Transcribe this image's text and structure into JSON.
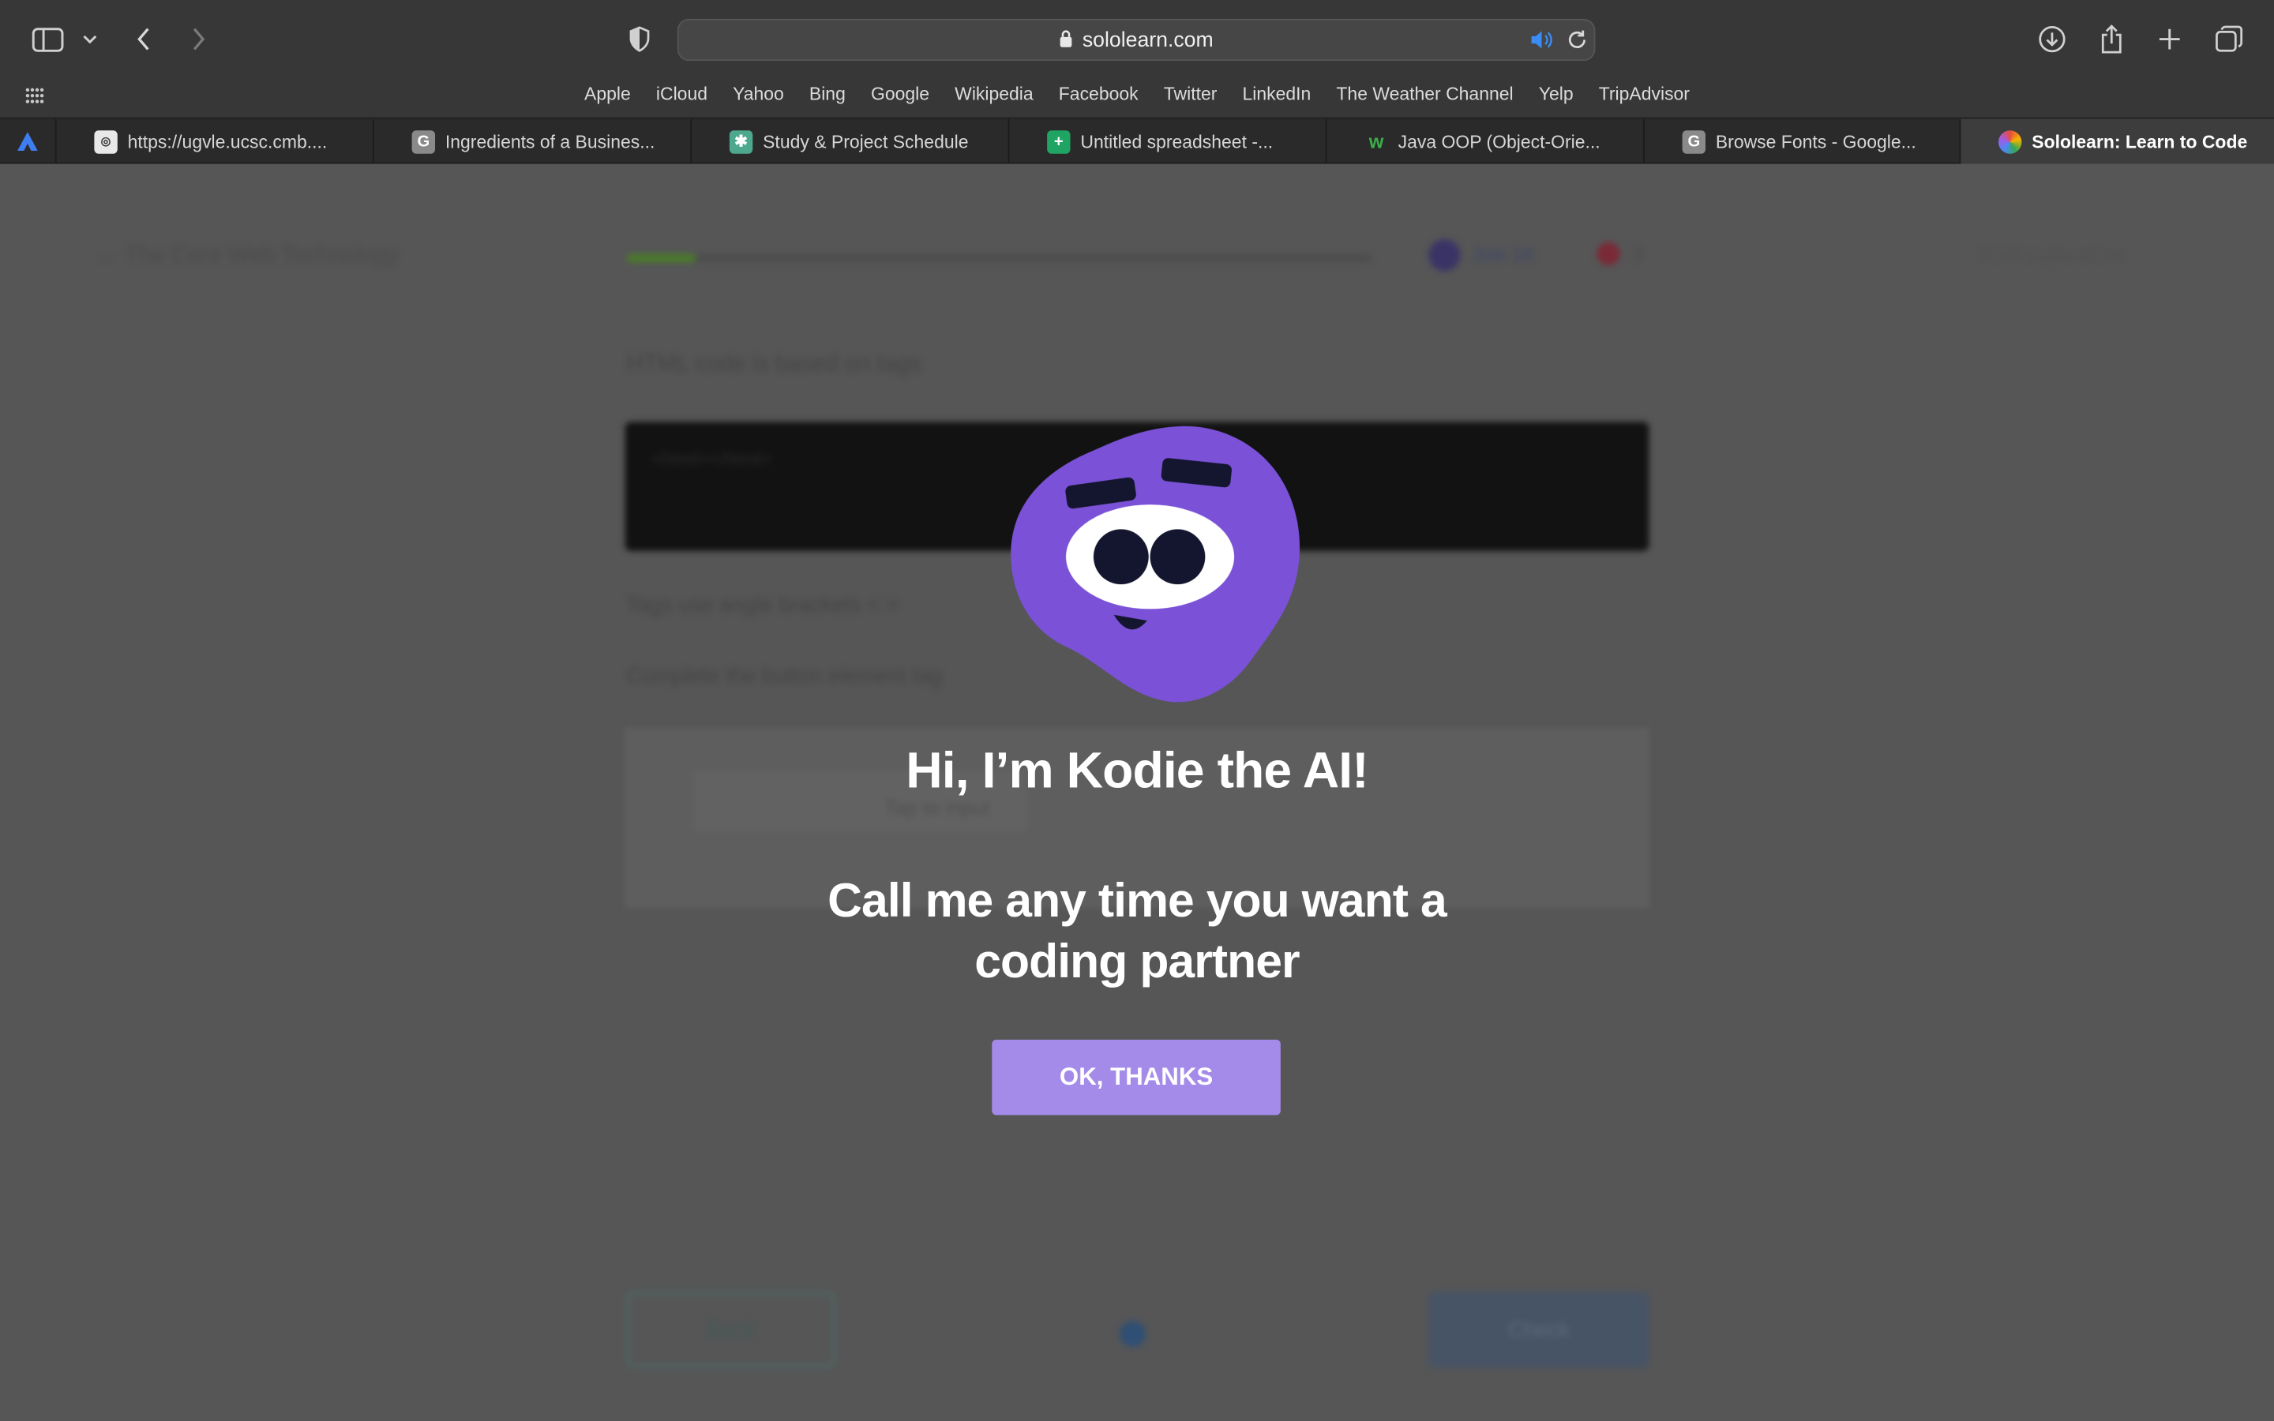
{
  "browser": {
    "url": "sololearn.com",
    "favorites": [
      "Apple",
      "iCloud",
      "Yahoo",
      "Bing",
      "Google",
      "Wikipedia",
      "Facebook",
      "Twitter",
      "LinkedIn",
      "The Weather Channel",
      "Yelp",
      "TripAdvisor"
    ],
    "tabs": [
      {
        "label": "https://ugvle.ucsc.cmb....",
        "icon": "ucsc-favicon"
      },
      {
        "label": "Ingredients of a Busines...",
        "icon": "g-favicon"
      },
      {
        "label": "Study & Project Schedule",
        "icon": "chatgpt-favicon"
      },
      {
        "label": "Untitled spreadsheet -...",
        "icon": "sheets-favicon"
      },
      {
        "label": "Java OOP (Object-Orie...",
        "icon": "w3schools-favicon"
      },
      {
        "label": "Browse Fonts - Google...",
        "icon": "g-favicon"
      },
      {
        "label": "Sololearn: Learn to Code",
        "icon": "sololearn-favicon",
        "active": true
      }
    ]
  },
  "background_page": {
    "back_label": "The Core Web Technology",
    "user_label": "Join 1K",
    "hearts": "3",
    "right_label": "No hi explanations",
    "text1": "HTML code is based on tags",
    "code_text": "<html></html>",
    "text2": "Tags use angle brackets < >",
    "text3": "Complete the button element tag",
    "field_text": "Tap to input",
    "back_button": "Back",
    "next_button": "Check"
  },
  "modal": {
    "title": "Hi, I’m Kodie the AI!",
    "subtitle_line1": "Call me any time you want a",
    "subtitle_line2": "coding partner",
    "button": "OK, THANKS",
    "mascot_color": "#7b52d7",
    "button_color": "#a58be9"
  }
}
